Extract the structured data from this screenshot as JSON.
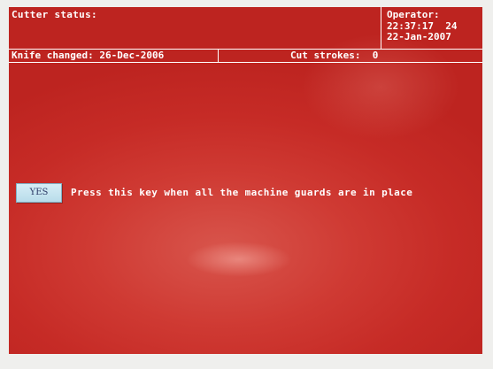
{
  "header": {
    "status_label": "Cutter status:",
    "operator_label": "Operator:",
    "time": "22:37:17",
    "time_suffix": "24",
    "date": "22-Jan-2007"
  },
  "info_bar": {
    "knife_changed": "Knife changed: 26-Dec-2006",
    "cut_strokes_label": "Cut strokes:",
    "cut_strokes_value": "0"
  },
  "confirm": {
    "button_label": "YES",
    "prompt_text": "Press this key when all the machine guards are in place"
  },
  "colors": {
    "screen_background": "#c62b26",
    "text": "#ffffff",
    "button_background": "#c4e4f0"
  }
}
